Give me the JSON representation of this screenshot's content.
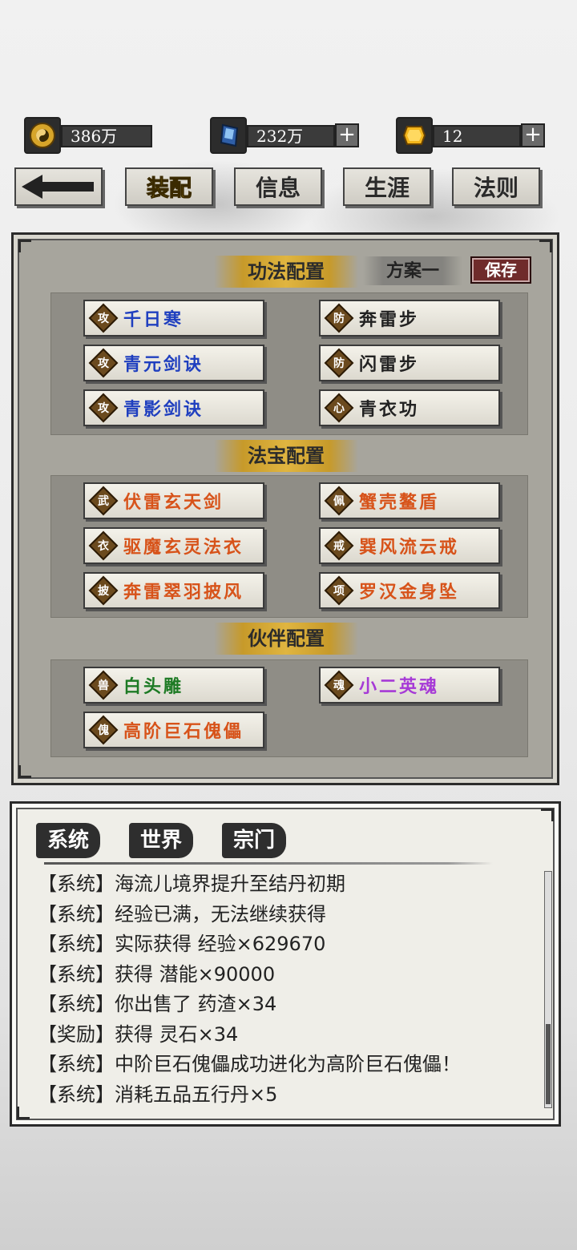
{
  "currencies": [
    {
      "icon": "yin-yang-coin-icon",
      "value": "386万",
      "has_plus": false
    },
    {
      "icon": "blue-spirit-stone-icon",
      "value": "232万",
      "has_plus": true
    },
    {
      "icon": "gold-ingot-icon",
      "value": "12",
      "has_plus": true
    }
  ],
  "nav": {
    "back_icon": "back-arrow-icon",
    "tabs": [
      "装配",
      "信息",
      "生涯",
      "法则"
    ],
    "active": "装配"
  },
  "config": {
    "skills_title": "功法配置",
    "plan_label": "方案一",
    "save_label": "保存",
    "skills": [
      {
        "tag": "攻",
        "name": "千日寒",
        "color": "#1f3fbf"
      },
      {
        "tag": "防",
        "name": "奔雷步",
        "color": "#222222"
      },
      {
        "tag": "攻",
        "name": "青元剑诀",
        "color": "#1f3fbf"
      },
      {
        "tag": "防",
        "name": "闪雷步",
        "color": "#222222"
      },
      {
        "tag": "攻",
        "name": "青影剑诀",
        "color": "#1f3fbf"
      },
      {
        "tag": "心",
        "name": "青衣功",
        "color": "#222222"
      }
    ],
    "treasures_title": "法宝配置",
    "treasures": [
      {
        "tag": "武",
        "name": "伏雷玄天剑",
        "color": "#d7531a"
      },
      {
        "tag": "佩",
        "name": "蟹壳鳌盾",
        "color": "#d7531a"
      },
      {
        "tag": "衣",
        "name": "驱魔玄灵法衣",
        "color": "#d7531a"
      },
      {
        "tag": "戒",
        "name": "巽风流云戒",
        "color": "#d7531a"
      },
      {
        "tag": "披",
        "name": "奔雷翠羽披风",
        "color": "#d7531a"
      },
      {
        "tag": "项",
        "name": "罗汉金身坠",
        "color": "#d7531a"
      }
    ],
    "partners_title": "伙伴配置",
    "partners": [
      {
        "tag": "兽",
        "name": "白头雕",
        "color": "#1d7a24"
      },
      {
        "tag": "魂",
        "name": "小二英魂",
        "color": "#a63ad6"
      },
      {
        "tag": "傀",
        "name": "高阶巨石傀儡",
        "color": "#d7531a"
      }
    ]
  },
  "chat": {
    "tabs": [
      "系统",
      "世界",
      "宗门"
    ],
    "active_tab": "系统",
    "messages": [
      "【系统】海流儿境界提升至结丹初期",
      "【系统】经验已满，无法继续获得",
      "【系统】实际获得 经验×629670",
      "【系统】获得 潜能×90000",
      "【系统】你出售了 药渣×34",
      "【奖励】获得 灵石×34",
      "【系统】中阶巨石傀儡成功进化为高阶巨石傀儡！",
      "【系统】消耗五品五行丹×5"
    ]
  }
}
